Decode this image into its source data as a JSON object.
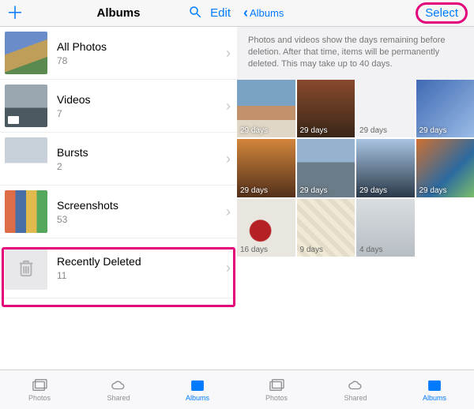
{
  "left": {
    "title": "Albums",
    "edit_label": "Edit",
    "albums": [
      {
        "name": "All Photos",
        "count": "78"
      },
      {
        "name": "Videos",
        "count": "7"
      },
      {
        "name": "Bursts",
        "count": "2"
      },
      {
        "name": "Screenshots",
        "count": "53"
      },
      {
        "name": "Recently Deleted",
        "count": "11"
      }
    ]
  },
  "right": {
    "back_label": "Albums",
    "select_label": "Select",
    "info_text": "Photos and videos show the days remaining before deletion. After that time, items will be permanently deleted. This may take up to 40 days.",
    "cells": [
      {
        "days": "29 days"
      },
      {
        "days": "29 days"
      },
      {
        "days": "29 days"
      },
      {
        "days": "29 days"
      },
      {
        "days": "29 days"
      },
      {
        "days": "29 days"
      },
      {
        "days": "29 days"
      },
      {
        "days": "29 days"
      },
      {
        "days": "16 days"
      },
      {
        "days": "9 days"
      },
      {
        "days": "4 days"
      }
    ]
  },
  "tabs": [
    {
      "label": "Photos"
    },
    {
      "label": "Shared"
    },
    {
      "label": "Albums"
    }
  ]
}
